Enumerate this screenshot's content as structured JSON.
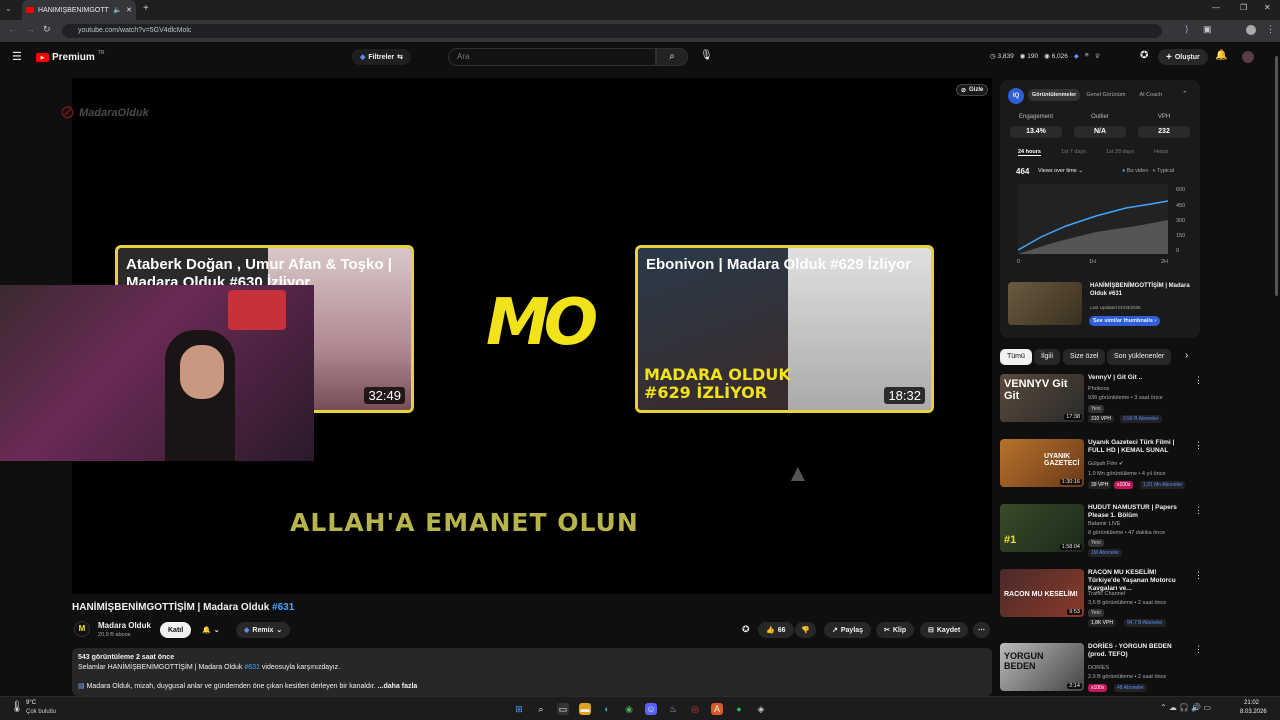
{
  "browser": {
    "tab_title": "HANİMİŞBENİMGOTTİŞİM | Madara...",
    "url": "youtube.com/watch?v=5GV4dlcMolc"
  },
  "header": {
    "logo": "Premium",
    "logo_sup": "TR",
    "filters": "Filtreler",
    "search_placeholder": "Ara",
    "stats": [
      "3,839",
      "190",
      "6,026"
    ],
    "create": "Oluştur"
  },
  "video": {
    "watermark": "MadaraOlduk",
    "card1_title": "Ataberk Doğan , Umur Afan & Toşko | Madara Olduk #630 İzliyor",
    "card1_duration": "32:49",
    "card2_title": "Ebonivon | Madara Olduk #629 İzliyor",
    "card2_duration": "18:32",
    "card2_overlay": "MADARA OLDUK\n#629 İZLİYOR",
    "center_logo": "MO",
    "end_text": "ALLAH'A EMANET OLUN",
    "hide": "Gizle"
  },
  "meta": {
    "title": "HANİMİŞBENİMGOTTİŞİM | Madara Olduk",
    "title_tag": "#631",
    "channel": "Madara Olduk",
    "subs": "20,9 B abone",
    "join": "Katıl",
    "remix": "Remix",
    "likes": "66",
    "share": "Paylaş",
    "clip": "Klip",
    "save": "Kaydet"
  },
  "description": {
    "line1": "543 görüntüleme  2 saat önce",
    "line2a": "Selamlar HANİMİŞBENİMGOTTİŞİM | Madara Olduk ",
    "line2tag": "#631",
    "line2b": " videosuyla karşınızdayız.",
    "line3": "Madara Olduk, mizah, duygusal anlar ve gündemden öne çıkan kesitleri derleyen bir kanaldır.",
    "more": "...daha fazla"
  },
  "panel": {
    "tabs": [
      "Görüntülenmeler",
      "Genel Görünüm",
      "AI Coach"
    ],
    "engagement_label": "Engagement",
    "engagement": "13.4%",
    "outliers_label": "Outlier",
    "outliers": "N/A",
    "vph_label": "VPH",
    "vph": "232",
    "periods": [
      "24 hours",
      "1st 7 days",
      "1st 28 days",
      "Hepsi"
    ],
    "views": "464",
    "views_mode": "Views over time",
    "legend": [
      "Bu video",
      "Typical"
    ],
    "yticks": [
      "600",
      "450",
      "300",
      "150",
      "0"
    ],
    "xticks": [
      "0",
      "1H",
      "2H"
    ],
    "thumb_title": "HANİMİŞBENİMGOTTİŞİM | Madara Olduk #631",
    "thumb_date": "Last Updated 01/03/2026",
    "similar_btn": "See similar thumbnails"
  },
  "chips": [
    "Tümü",
    "İlgili",
    "Size özel",
    "Son yüklenenler"
  ],
  "recs": [
    {
      "title": "VennyV | Git Git ..",
      "channel": "Phrikoos",
      "meta": "936 görüntüleme • 3 saat önce",
      "tag": "Yeni",
      "vph": "310 VPH",
      "subs": "3,56 B Aboneler",
      "dur": "17:38",
      "thumb": "VENNYV Git Git",
      "c1": "#5a4a3a",
      "c2": "#2a2a2a"
    },
    {
      "title": "Uyanık Gazeteci Türk Filmi | FULL HD | KEMAL SUNAL",
      "channel": "Gülşah Film",
      "meta": "1,9 Mn görüntüleme • 4 yıl önce",
      "tag": "",
      "vph": "39 VPH",
      "mult": "x100x",
      "subs": "1,81 Mn Aboneler",
      "dur": "1:30:16",
      "thumb": "UYANIK GAZETECİ",
      "c1": "#b8722a",
      "c2": "#6a3a1a"
    },
    {
      "title": "HUDUT NAMUSTUR | Papers Please 1. Bölüm",
      "channel": "Batamir LIVE",
      "meta": "8 görüntüleme • 47 dakika önce",
      "tag": "Yeni",
      "vph": "",
      "subs": "1M Aboneler",
      "dur": "1:58:04",
      "thumb": "#1",
      "c1": "#3a4a2a",
      "c2": "#1a2a1a"
    },
    {
      "title": "RACON MU KESELİM! Türkiye'de Yaşanan Motorcu Kavgaları ve...",
      "channel": "Traffic Channel",
      "meta": "3,6 B görüntüleme • 2 saat önce",
      "tag": "Yeni",
      "vph": "1,8K VPH",
      "subs": "94,7 B Aboneler",
      "dur": "9:53",
      "thumb": "RACON MU KESELİM!",
      "c1": "#4a2a2a",
      "c2": "#8a3a2a"
    },
    {
      "title": "DORİES - YORGUN BEDEN (prod. TEFO)",
      "channel": "DORİES",
      "meta": "2,9 B görüntüleme • 2 saat önce",
      "tag": "",
      "vph": "",
      "mult": "x100x",
      "subs": "48 Aboneler",
      "dur": "2:14",
      "thumb": "YORGUN BEDEN",
      "c1": "#bbbbbb",
      "c2": "#444444"
    }
  ],
  "taskbar": {
    "weather_temp": "9°C",
    "weather_desc": "Çok bulutlu",
    "time": "21:02",
    "date": "8.03.2026"
  }
}
